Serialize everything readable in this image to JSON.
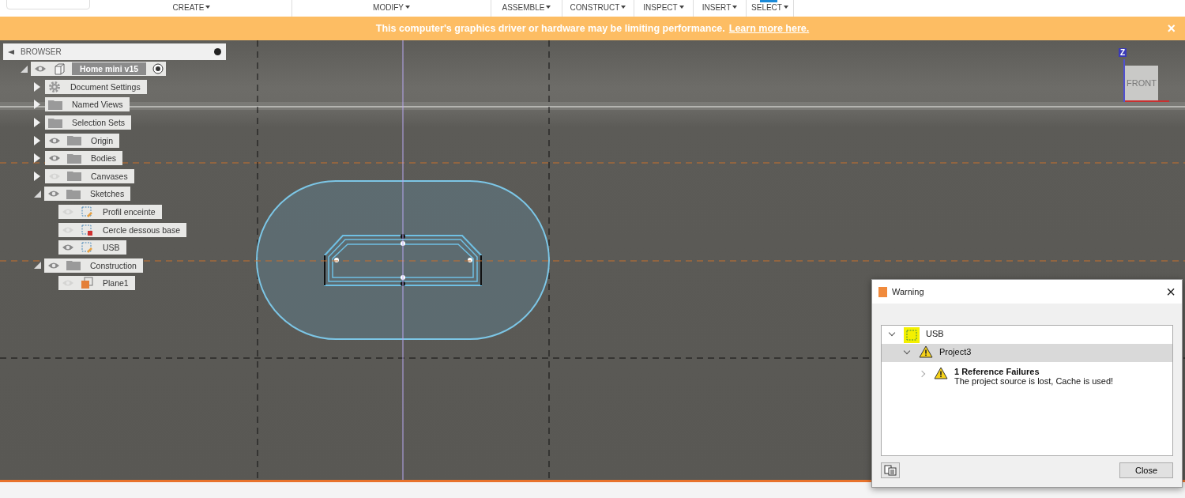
{
  "toolbar": {
    "menus": [
      {
        "label": "CREATE"
      },
      {
        "label": "MODIFY"
      },
      {
        "label": "ASSEMBLE"
      },
      {
        "label": "CONSTRUCT"
      },
      {
        "label": "INSPECT"
      },
      {
        "label": "INSERT"
      },
      {
        "label": "SELECT"
      }
    ]
  },
  "banner": {
    "message": "This computer's graphics driver or hardware may be limiting performance.",
    "link": "Learn more here.",
    "close": "×"
  },
  "browser": {
    "title": "BROWSER",
    "items": [
      {
        "label": "Home mini v15",
        "kind": "component",
        "visible": true,
        "expanded": true,
        "children": [
          {
            "label": "Document Settings",
            "kind": "settings",
            "expanded": false
          },
          {
            "label": "Named Views",
            "kind": "folder",
            "expanded": false
          },
          {
            "label": "Selection Sets",
            "kind": "folder",
            "expanded": false
          },
          {
            "label": "Origin",
            "kind": "folder",
            "visible": true,
            "expanded": false
          },
          {
            "label": "Bodies",
            "kind": "folder",
            "visible": true,
            "expanded": false
          },
          {
            "label": "Canvases",
            "kind": "folder",
            "visible": false,
            "expanded": false
          },
          {
            "label": "Sketches",
            "kind": "folder",
            "visible": true,
            "expanded": true,
            "children": [
              {
                "label": "Profil enceinte",
                "kind": "sketch",
                "visible": false
              },
              {
                "label": "Cercle dessous base",
                "kind": "sketch-locked",
                "visible": false
              },
              {
                "label": "USB",
                "kind": "sketch",
                "visible": true
              }
            ]
          },
          {
            "label": "Construction",
            "kind": "folder",
            "visible": true,
            "expanded": true,
            "children": [
              {
                "label": "Plane1",
                "kind": "plane",
                "visible": false
              }
            ]
          }
        ]
      }
    ]
  },
  "viewcube": {
    "face": "FRONT",
    "axis": "Z"
  },
  "dialog": {
    "title": "Warning",
    "close": "×",
    "tree": [
      {
        "label": "USB",
        "kind": "sketch",
        "expanded": true,
        "selected": false
      },
      {
        "label": "Project3",
        "kind": "warning",
        "expanded": true,
        "selected": true
      },
      {
        "label": "1 Reference Failures",
        "detail": "The project source is lost, Cache is used!",
        "kind": "warning",
        "expanded": false,
        "selected": false
      }
    ],
    "button": "Close"
  }
}
